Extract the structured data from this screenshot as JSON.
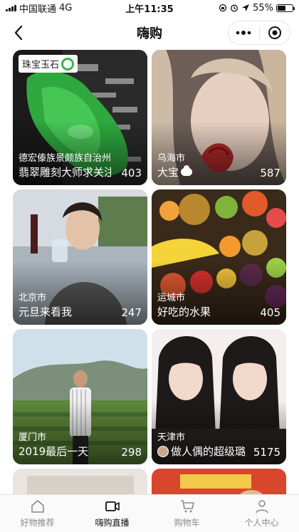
{
  "status_bar": {
    "carrier": "中国联通",
    "network": "4G",
    "time": "上午11:35",
    "battery": "55%",
    "battery_level": 0.55
  },
  "nav": {
    "title": "嗨购"
  },
  "cards": [
    {
      "tag": "珠宝玉石",
      "location": "德宏傣族景颇族自治州",
      "title": "翡翠雕刻大师求关注",
      "count": "403"
    },
    {
      "location": "乌海市",
      "title": "大宝",
      "count": "587"
    },
    {
      "location": "北京市",
      "title": "元旦来看我",
      "count": "247"
    },
    {
      "location": "运城市",
      "title": "好吃的水果",
      "count": "405"
    },
    {
      "location": "厦门市",
      "title": "2019最后一天",
      "count": "298"
    },
    {
      "location": "天津市",
      "title": "做人偶的超级璐",
      "count": "5175"
    }
  ],
  "tab_bar": {
    "items": [
      {
        "label": "好物推荐",
        "icon": "home-icon"
      },
      {
        "label": "嗨购直播",
        "icon": "video-icon"
      },
      {
        "label": "购物车",
        "icon": "cart-icon"
      },
      {
        "label": "个人中心",
        "icon": "person-icon"
      }
    ],
    "active_index": 1
  }
}
